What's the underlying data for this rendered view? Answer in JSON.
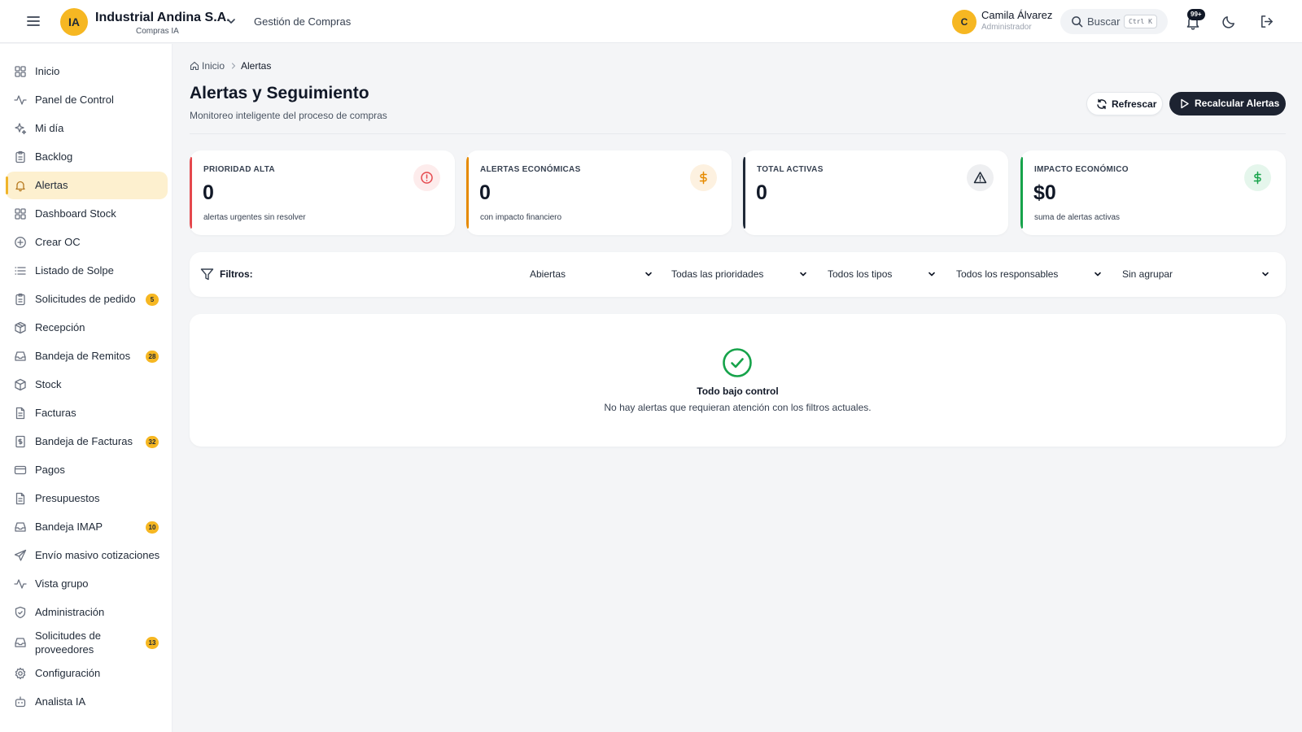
{
  "header": {
    "company_initials": "IA",
    "company_name": "Industrial Andina S.A.",
    "company_sub": "Compras IA",
    "module": "Gestión de Compras",
    "user_initial": "C",
    "user_name": "Camila Álvarez",
    "user_role": "Administrador",
    "search_label": "Buscar",
    "search_shortcut": "Ctrl K",
    "notifications_badge": "99+"
  },
  "sidebar": {
    "items": [
      {
        "label": "Inicio",
        "icon": "grid-icon"
      },
      {
        "label": "Panel de Control",
        "icon": "activity-icon"
      },
      {
        "label": "Mi día",
        "icon": "sparkles-icon"
      },
      {
        "label": "Backlog",
        "icon": "clipboard-icon"
      },
      {
        "label": "Alertas",
        "icon": "bell-icon",
        "active": true
      },
      {
        "label": "Dashboard Stock",
        "icon": "grid-icon"
      },
      {
        "label": "Crear OC",
        "icon": "plus-circle-icon"
      },
      {
        "label": "Listado de Solpe",
        "icon": "list-icon"
      },
      {
        "label": "Solicitudes de pedido",
        "icon": "clipboard-icon",
        "badge": "5"
      },
      {
        "label": "Recepción",
        "icon": "package-icon"
      },
      {
        "label": "Bandeja de Remitos",
        "icon": "inbox-icon",
        "badge": "28"
      },
      {
        "label": "Stock",
        "icon": "box-icon"
      },
      {
        "label": "Facturas",
        "icon": "file-text-icon"
      },
      {
        "label": "Bandeja de Facturas",
        "icon": "receipt-icon",
        "badge": "32"
      },
      {
        "label": "Pagos",
        "icon": "credit-card-icon"
      },
      {
        "label": "Presupuestos",
        "icon": "file-text-icon"
      },
      {
        "label": "Bandeja IMAP",
        "icon": "inbox-icon",
        "badge": "10"
      },
      {
        "label": "Envío masivo cotizaciones",
        "icon": "send-icon"
      },
      {
        "label": "Vista grupo",
        "icon": "activity-icon"
      },
      {
        "label": "Administración",
        "icon": "shield-icon"
      },
      {
        "label": "Solicitudes de proveedores",
        "icon": "inbox-icon",
        "badge": "13"
      },
      {
        "label": "Configuración",
        "icon": "gear-icon"
      },
      {
        "label": "Analista IA",
        "icon": "bot-icon"
      }
    ]
  },
  "breadcrumb": {
    "home": "Inicio",
    "current": "Alertas"
  },
  "page": {
    "title": "Alertas y Seguimiento",
    "subtitle": "Monitoreo inteligente del proceso de compras",
    "refresh_label": "Refrescar",
    "recalc_label": "Recalcular Alertas"
  },
  "cards": [
    {
      "label": "PRIORIDAD ALTA",
      "value": "0",
      "caption": "alertas urgentes sin resolver",
      "accent": "#e5484d",
      "icon": "alert-circle-icon"
    },
    {
      "label": "ALERTAS ECONÓMICAS",
      "value": "0",
      "caption": "con impacto financiero",
      "accent": "#e68a00",
      "icon": "dollar-icon"
    },
    {
      "label": "TOTAL ACTIVAS",
      "value": "0",
      "caption": "",
      "accent": "#1f2937",
      "icon": "alert-triangle-icon"
    },
    {
      "label": "IMPACTO ECONÓMICO",
      "value": "$0",
      "caption": "suma de alertas activas",
      "accent": "#16a34a",
      "icon": "dollar-icon"
    }
  ],
  "filters": {
    "label": "Filtros:",
    "status": "Abiertas",
    "priority": "Todas las prioridades",
    "type": "Todos los tipos",
    "owner": "Todos los responsables",
    "grouping": "Sin agrupar"
  },
  "empty_state": {
    "title": "Todo bajo control",
    "text": "No hay alertas que requieran atención con los filtros actuales."
  }
}
